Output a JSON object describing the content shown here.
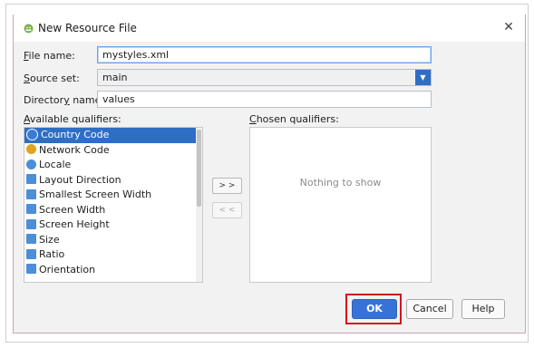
{
  "window": {
    "title": "New Resource File",
    "close_symbol": "✕"
  },
  "form": {
    "file_name_label_prefix": "F",
    "file_name_label_rest": "ile name:",
    "file_name_value": "mystyles.xml",
    "source_set_label_prefix": "S",
    "source_set_label_rest": "ource set:",
    "source_set_value": "main",
    "directory_label_pre": "Director",
    "directory_label_u": "y",
    "directory_label_post": " name:",
    "directory_value": "values"
  },
  "qualifiers": {
    "available_label_prefix": "A",
    "available_label_rest": "vailable qualifiers:",
    "chosen_label_pre": "C",
    "chosen_label_rest": "hosen qualifiers:",
    "available_items": [
      {
        "label": "Country Code",
        "icon": "country-code-icon",
        "color": "#3a7bd5"
      },
      {
        "label": "Network Code",
        "icon": "network-code-icon",
        "color": "#e0a31f"
      },
      {
        "label": "Locale",
        "icon": "locale-icon",
        "color": "#4a8fd8"
      },
      {
        "label": "Layout Direction",
        "icon": "layout-direction-icon",
        "color": "#4a8fd8"
      },
      {
        "label": "Smallest Screen Width",
        "icon": "smallest-width-icon",
        "color": "#4a8fd8"
      },
      {
        "label": "Screen Width",
        "icon": "screen-width-icon",
        "color": "#4a8fd8"
      },
      {
        "label": "Screen Height",
        "icon": "screen-height-icon",
        "color": "#4a8fd8"
      },
      {
        "label": "Size",
        "icon": "size-icon",
        "color": "#4a8fd8"
      },
      {
        "label": "Ratio",
        "icon": "ratio-icon",
        "color": "#4a8fd8"
      },
      {
        "label": "Orientation",
        "icon": "orientation-icon",
        "color": "#4a8fd8"
      }
    ],
    "add_button": "> >",
    "remove_button": "< <",
    "chosen_empty_text": "Nothing to show"
  },
  "buttons": {
    "ok": "OK",
    "cancel": "Cancel",
    "help": "Help"
  },
  "colors": {
    "accent": "#3574d6",
    "selection": "#2f6ec5",
    "highlight_box": "#d3151e"
  }
}
